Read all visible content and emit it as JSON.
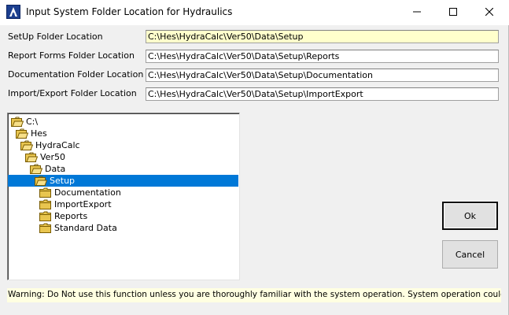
{
  "window": {
    "title": "Input System Folder Location for Hydraulics",
    "app_icon": "hydracalc-app-icon",
    "controls": {
      "minimize": "minimize-icon",
      "maximize": "maximize-icon",
      "close": "close-icon"
    }
  },
  "fields": [
    {
      "label": "SetUp Folder Location",
      "value": "C:\\Hes\\HydraCalc\\Ver50\\Data\\Setup"
    },
    {
      "label": "Report Forms Folder Location",
      "value": "C:\\Hes\\HydraCalc\\Ver50\\Data\\Setup\\Reports"
    },
    {
      "label": "Documentation Folder Location",
      "value": "C:\\Hes\\HydraCalc\\Ver50\\Data\\Setup\\Documentation"
    },
    {
      "label": "Import/Export  Folder Location",
      "value": "C:\\Hes\\HydraCalc\\Ver50\\Data\\Setup\\ImportExport"
    }
  ],
  "folder_tree": {
    "items": [
      {
        "label": "C:\\",
        "depth": 0,
        "open": true,
        "selected": false
      },
      {
        "label": "Hes",
        "depth": 1,
        "open": true,
        "selected": false
      },
      {
        "label": "HydraCalc",
        "depth": 2,
        "open": true,
        "selected": false
      },
      {
        "label": "Ver50",
        "depth": 3,
        "open": true,
        "selected": false
      },
      {
        "label": "Data",
        "depth": 4,
        "open": true,
        "selected": false
      },
      {
        "label": "Setup",
        "depth": 5,
        "open": true,
        "selected": true
      },
      {
        "label": "Documentation",
        "depth": 6,
        "open": false,
        "selected": false
      },
      {
        "label": "ImportExport",
        "depth": 6,
        "open": false,
        "selected": false
      },
      {
        "label": "Reports",
        "depth": 6,
        "open": false,
        "selected": false
      },
      {
        "label": "Standard Data",
        "depth": 6,
        "open": false,
        "selected": false
      }
    ]
  },
  "buttons": {
    "ok": "Ok",
    "cancel": "Cancel"
  },
  "warning": "Warning: Do Not use this function unless you are thoroughly familiar with the system operation.  System operation could be impaired !",
  "colors": {
    "selection": "#0078d7",
    "active_field": "#ffffcc",
    "warning_bg": "#ffffe1",
    "folder": "#e8c54f"
  }
}
